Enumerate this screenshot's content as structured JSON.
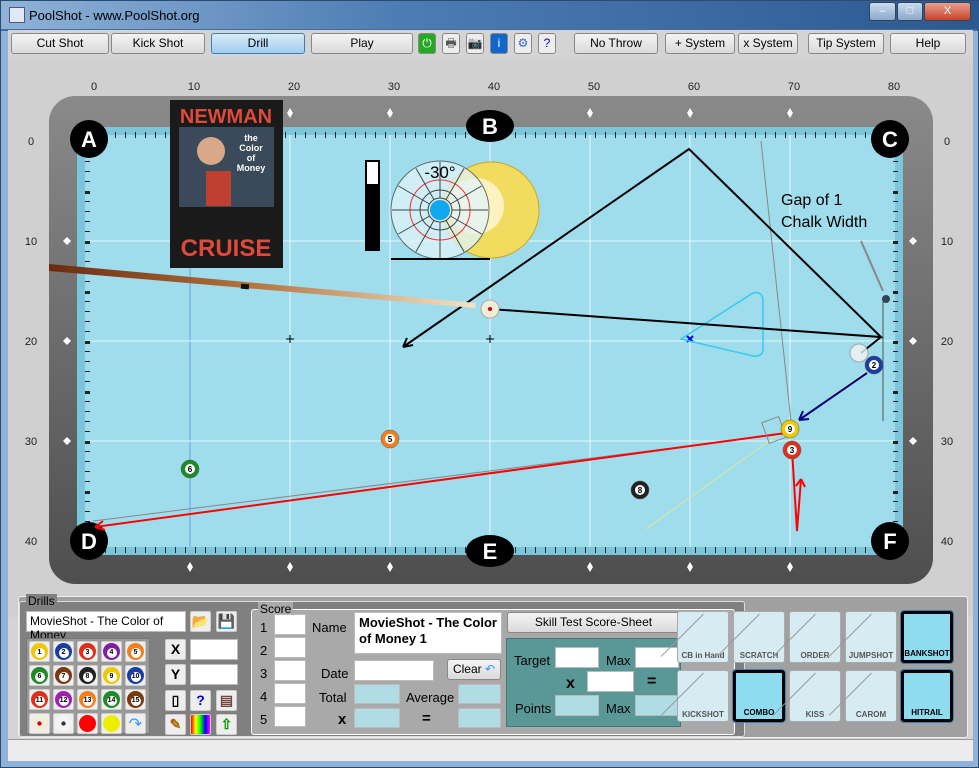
{
  "window": {
    "title": "PoolShot - www.PoolShot.org",
    "minimize": "–",
    "maximize": "□",
    "close": "X"
  },
  "toolbar": {
    "buttons": [
      {
        "label": "Cut Shot"
      },
      {
        "label": "Kick Shot"
      },
      {
        "label": "Drill",
        "active": true
      },
      {
        "label": "Play"
      }
    ],
    "icons": [
      "power-icon",
      "print-icon",
      "camera-icon",
      "info-icon",
      "settings-icon",
      "help-doc-icon"
    ],
    "buttons2": [
      {
        "label": "No Throw Lines"
      },
      {
        "label": "+ System"
      },
      {
        "label": "x System"
      },
      {
        "label": "Tip System"
      },
      {
        "label": "Help"
      }
    ]
  },
  "table": {
    "x_ticks": [
      "0",
      "10",
      "20",
      "30",
      "40",
      "50",
      "60",
      "70",
      "80"
    ],
    "y_ticks": [
      "0",
      "10",
      "20",
      "30",
      "40"
    ],
    "pockets": [
      "A",
      "B",
      "C",
      "D",
      "E",
      "F"
    ],
    "annotation": [
      "Gap of 1",
      "Chalk Width"
    ],
    "english_angle": "-30°",
    "poster": {
      "top": "NEWMAN",
      "title": [
        "the",
        "Color",
        "of",
        "Money"
      ],
      "bottom": "CRUISE"
    },
    "balls": [
      "cue",
      "9",
      "3",
      "2",
      "5",
      "6",
      "8"
    ],
    "colors": {
      "cloth": "#9fdcec",
      "rail": "#6b6b6b",
      "aim_line": "#000000",
      "object_path": "#ff0000",
      "cue_path": "#000080",
      "rack": "#33ccee"
    }
  },
  "drills": {
    "legend": "Drills",
    "name": "MovieShot - The Color of Money",
    "x_label": "X",
    "y_label": "Y",
    "x_value": "",
    "y_value": "",
    "balls": [
      "1",
      "2",
      "3",
      "4",
      "5",
      "6",
      "7",
      "8",
      "9",
      "10",
      "11",
      "12",
      "13",
      "14",
      "15"
    ],
    "extras": [
      "cue-ball-red-dot",
      "cue-ball-black-dot",
      "red-ball",
      "yellow-ball",
      "redo"
    ]
  },
  "score": {
    "legend": "Score",
    "rows": [
      "1",
      "2",
      "3",
      "4",
      "5"
    ],
    "name_label": "Name",
    "name_value": "MovieShot - The Color of Money 1",
    "date_label": "Date",
    "total_label": "Total",
    "average_label": "Average",
    "x_label": "x",
    "eq_label": "=",
    "clear_label": "Clear",
    "sheet_button": "Skill Test Score-Sheet",
    "target_label": "Target",
    "max_label": "Max",
    "points_label": "Points",
    "max2_label": "Max",
    "mult": "x",
    "eq": "="
  },
  "shot_types": [
    {
      "label": "CB in Hand",
      "active": false
    },
    {
      "label": "SCRATCH",
      "active": false
    },
    {
      "label": "ORDER",
      "active": false
    },
    {
      "label": "JUMPSHOT",
      "active": false
    },
    {
      "label": "BANKSHOT",
      "active": true
    },
    {
      "label": "KICKSHOT",
      "active": false
    },
    {
      "label": "COMBO",
      "active": true
    },
    {
      "label": "KISS",
      "active": false
    },
    {
      "label": "CAROM",
      "active": false
    },
    {
      "label": "HITRAIL",
      "active": true
    }
  ]
}
